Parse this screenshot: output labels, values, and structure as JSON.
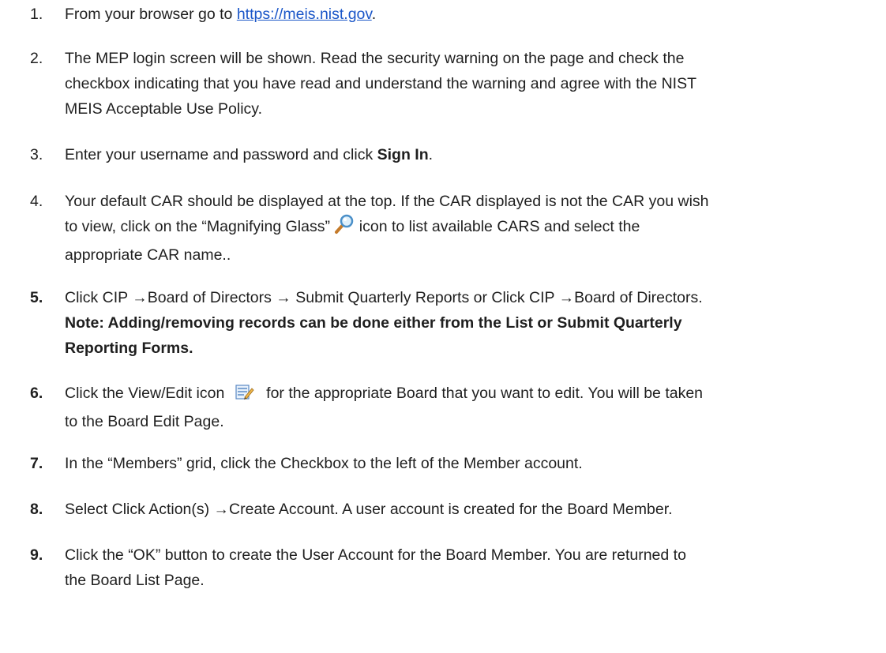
{
  "steps": [
    {
      "number": "1.",
      "text_before": "From your browser go to ",
      "link": "https://meis.nist.gov",
      "text_after": "."
    },
    {
      "number": "2.",
      "line1": "The MEP login screen will be shown. Read the security warning on the page and check the",
      "line2": "checkbox indicating that you have read and understand the warning and agree with the NIST",
      "line3": "MEIS Acceptable Use Policy."
    },
    {
      "number": "3.",
      "text_before": "Enter your username and password and click ",
      "bold": "Sign In",
      "text_after": "."
    },
    {
      "number": "4.",
      "line1": "Your default CAR should be displayed at the top. If the CAR displayed is not the CAR you wish",
      "line2_before": "to view, click on the “Magnifying Glass” ",
      "line2_after": " icon to list available CARS and select the",
      "line3": "appropriate CAR name.."
    },
    {
      "number": "5.",
      "line1": "Click CIP →Board of Directors → Submit Quarterly Reports or Click CIP →Board of Directors.",
      "note_line1": "Note: Adding/removing records can be done either from the List or Submit Quarterly",
      "note_line2": "Reporting Forms."
    },
    {
      "number": "6.",
      "line1_before": "Click the View/Edit icon ",
      "line1_after": " for the appropriate Board that you want to edit. You will be taken",
      "line2": "to the Board Edit Page."
    },
    {
      "number": "7.",
      "text": "In the “Members” grid, click the Checkbox to the left of the Member account."
    },
    {
      "number": "8.",
      "text": "Select Click Action(s) →Create Account. A user account is created for the Board Member."
    },
    {
      "number": "9.",
      "line1": "Click the “OK” button to create the User Account for the Board Member. You are returned to",
      "line2": "the Board List Page."
    }
  ],
  "icons": {
    "magnifier": "magnifying-glass-icon",
    "view_edit": "view-edit-icon"
  }
}
